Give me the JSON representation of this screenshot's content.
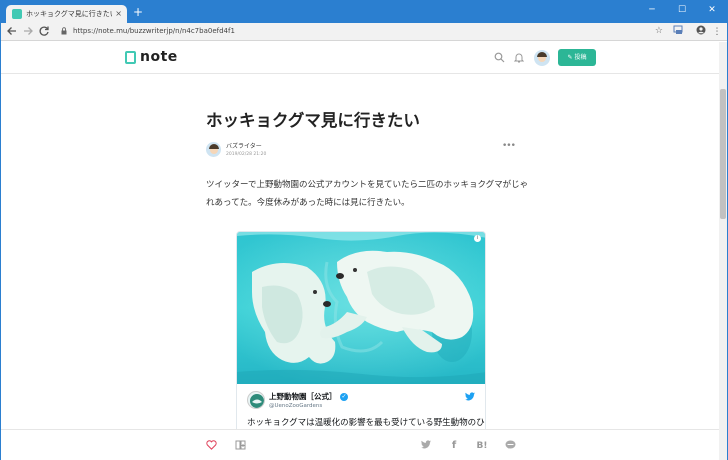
{
  "browser": {
    "tab_title": "ホッキョクグマ見に行きたい｜バズライ",
    "tab_close": "×",
    "new_tab": "+",
    "url": "https://note.mu/buzzwriterjp/n/n4c7ba0efd4f1",
    "controls": {
      "minimize": "─",
      "maximize": "☐",
      "close": "✕"
    }
  },
  "site": {
    "logo_text": "note",
    "post_button": "投稿"
  },
  "article": {
    "title": "ホッキョクグマ見に行きたい",
    "author": "バズライター",
    "date": "2019/02/28 21:20",
    "body": "ツイッターで上野動物園の公式アカウントを見ていたら二匹のホッキョクグマがじゃれあってた。今度休みがあった時には見に行きたい。"
  },
  "tweet": {
    "name": "上野動物園［公式］",
    "handle": "@UenoZooGardens",
    "text": "ホッキョクグマは温暖化の影響を最も受けている野生動物のひ"
  },
  "icons": {
    "back": "arrow-left-icon",
    "forward": "arrow-right-icon",
    "reload": "reload-icon",
    "search": "search-icon",
    "bell": "bell-icon",
    "like": "heart-icon",
    "magazine": "magazine-icon",
    "twitter": "twitter-icon",
    "facebook": "facebook-icon",
    "hatena": "hatena-bookmark-icon",
    "line": "line-icon"
  },
  "colors": {
    "brand": "#41c9b4",
    "post_button": "#2cb696",
    "chrome_frame": "#2b7fd0",
    "like": "#e0475f"
  }
}
